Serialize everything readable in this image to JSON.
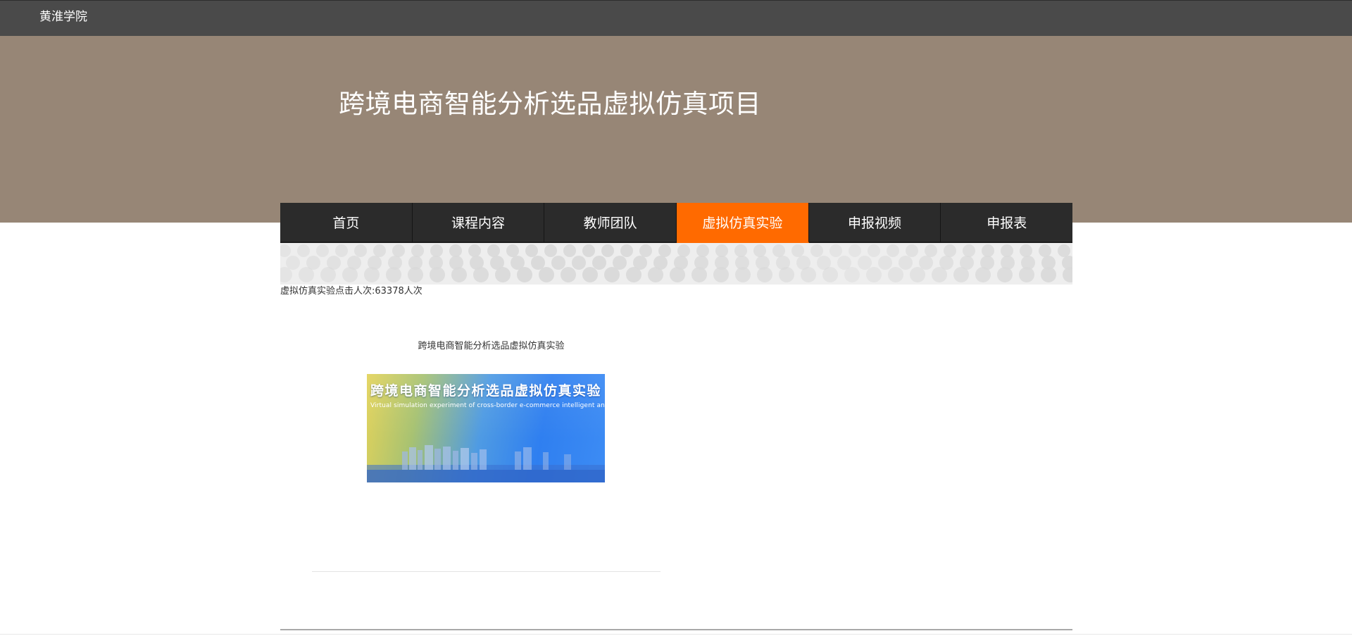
{
  "topbar": {
    "brand": "黄淮学院"
  },
  "banner": {
    "title": "跨境电商智能分析选品虚拟仿真项目"
  },
  "nav": {
    "items": [
      {
        "label": "首页",
        "active": false
      },
      {
        "label": "课程内容",
        "active": false
      },
      {
        "label": "教师团队",
        "active": false
      },
      {
        "label": "虚拟仿真实验",
        "active": true
      },
      {
        "label": "申报视频",
        "active": false
      },
      {
        "label": "申报表",
        "active": false
      }
    ],
    "active_color": "#ff6a00",
    "bar_color": "#2b2b2b"
  },
  "counter": {
    "label": "虚拟仿真实验点击人次:",
    "value": "63378",
    "unit": "人次"
  },
  "experiment": {
    "title": "跨境电商智能分析选品虚拟仿真实验",
    "image_title": "跨境电商智能分析选品虚拟仿真实验",
    "image_subtitle": "Virtual simulation experiment of cross-border e-commerce intelligent analysis"
  },
  "colors": {
    "topbar": "#4a4a4a",
    "banner": "#978676"
  }
}
